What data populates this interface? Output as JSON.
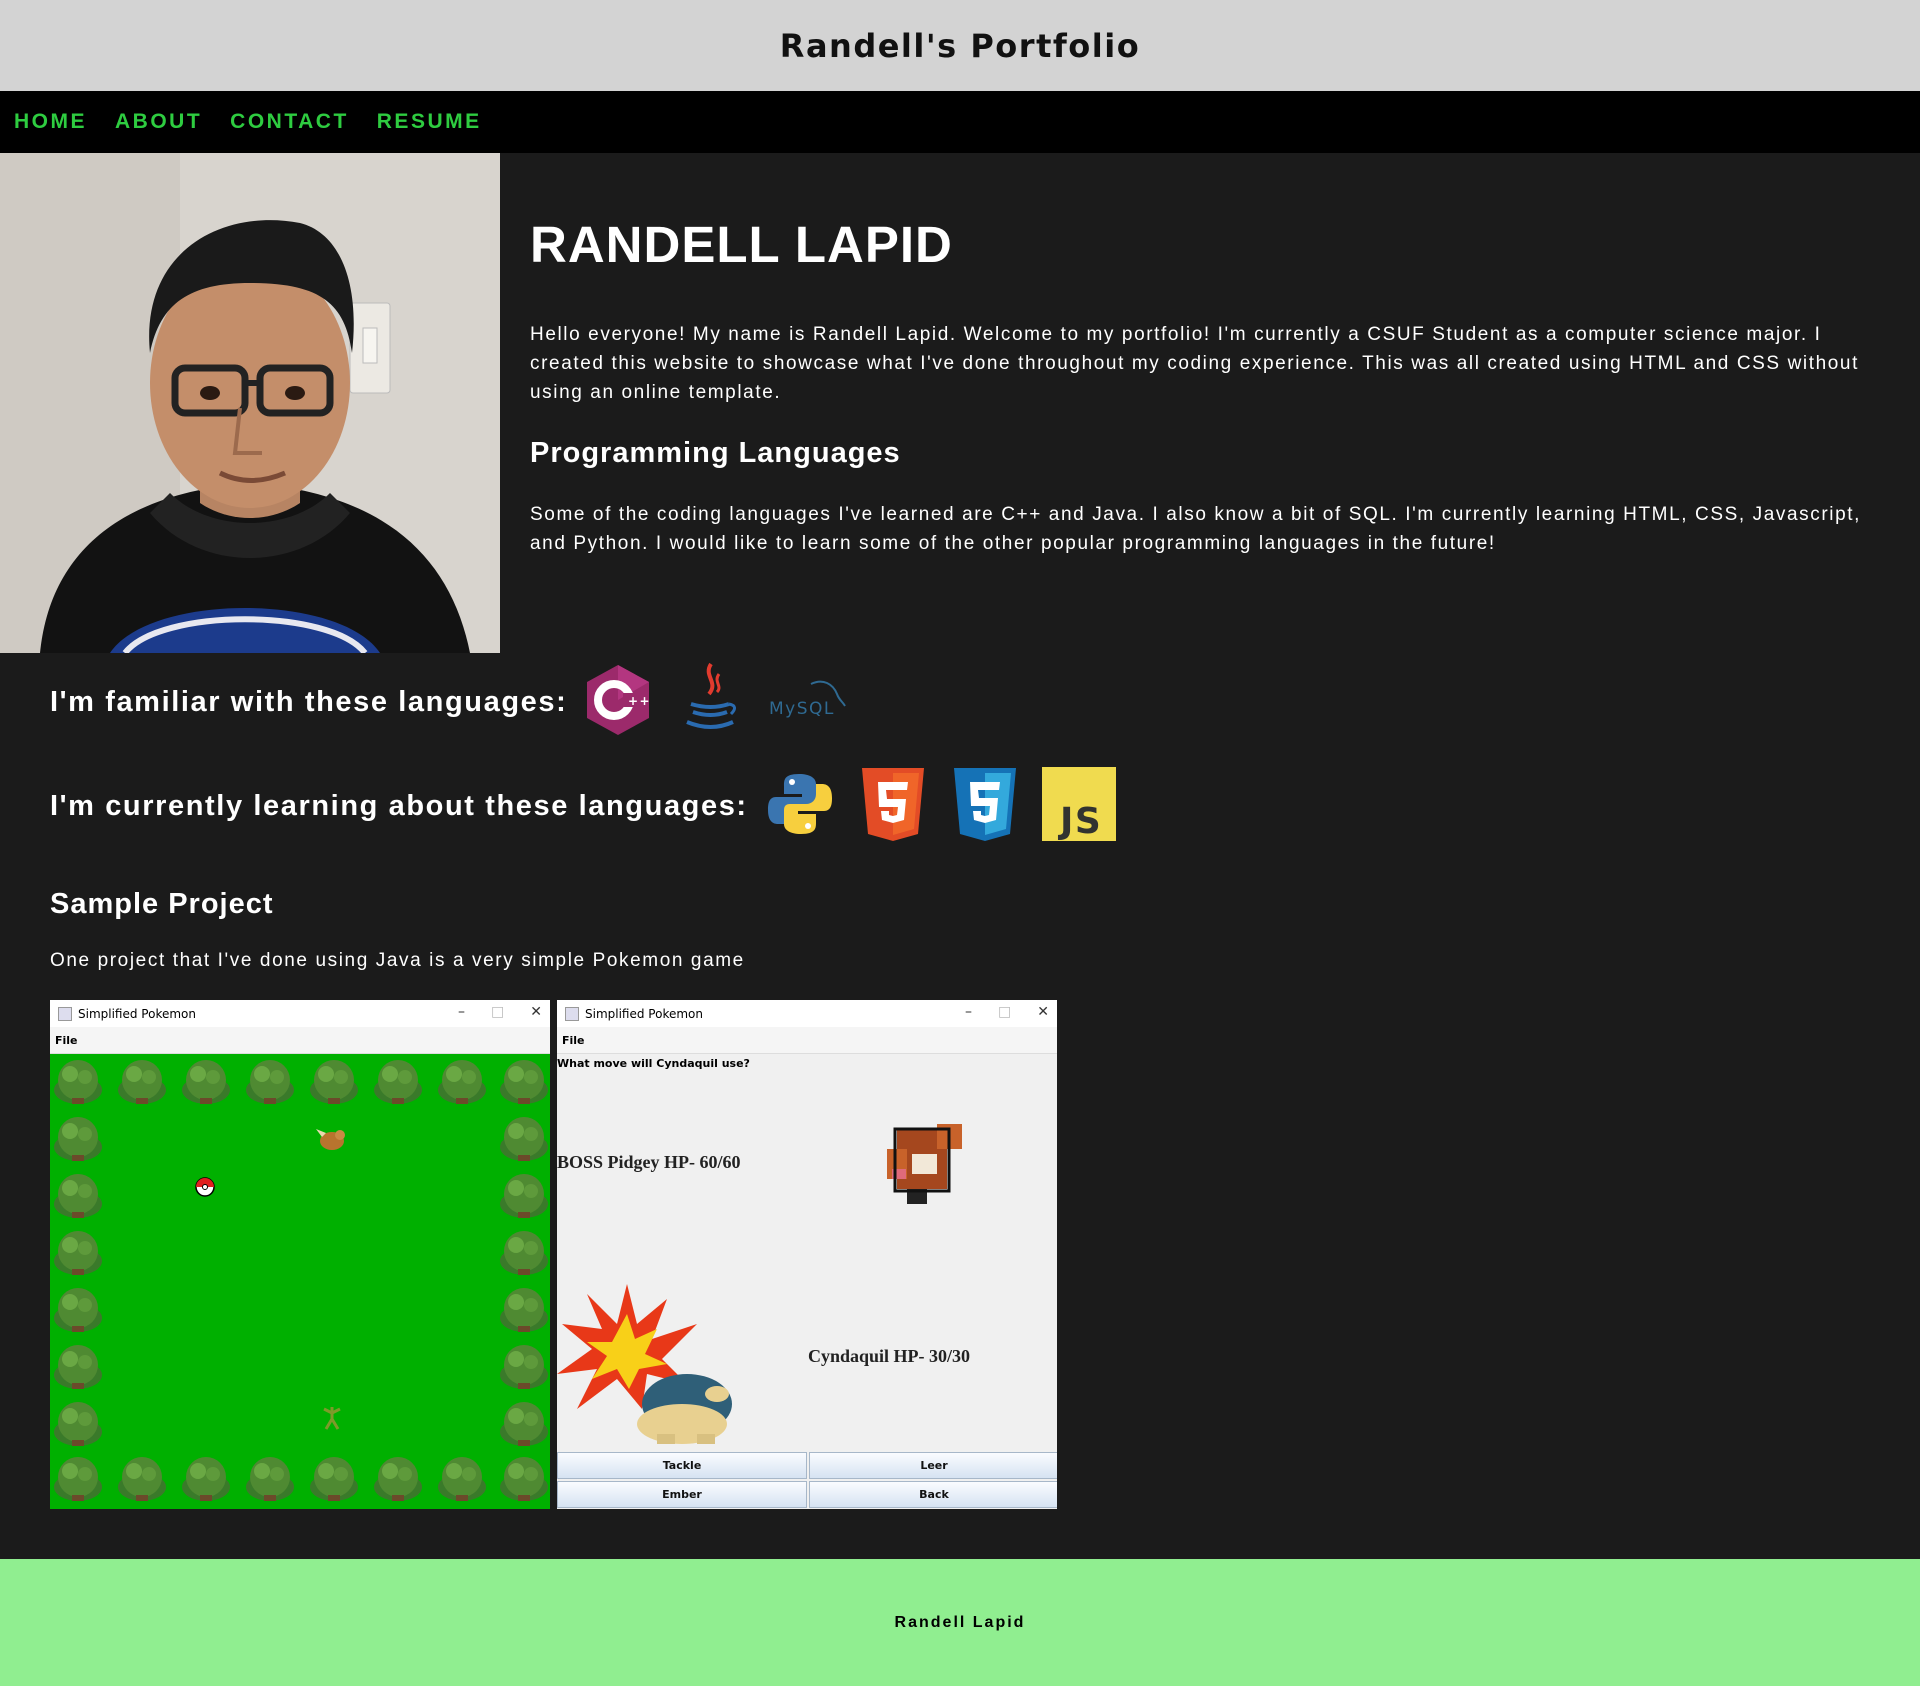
{
  "header": {
    "title": "Randell's Portfolio"
  },
  "nav": {
    "items": [
      "HOME",
      "ABOUT",
      "CONTACT",
      "RESUME"
    ]
  },
  "intro": {
    "name": "RANDELL LAPID",
    "paragraph": "Hello everyone! My name is Randell Lapid. Welcome to my portfolio! I'm currently a CSUF Student as a computer science major. I created this website to showcase what I've done throughout my coding experience. This was all created using HTML and CSS without using an online template.",
    "languages_heading": "Programming Languages",
    "languages_paragraph": "Some of the coding languages I've learned are C++ and Java. I also know a bit of SQL. I'm currently learning HTML, CSS, Javascript, and Python. I would like to learn some of the other popular programming languages in the future!"
  },
  "familiar": {
    "heading": "I'm familiar with these languages:",
    "icons": [
      "cpp-icon",
      "java-icon",
      "mysql-icon"
    ],
    "mysql_text": "MySQL"
  },
  "learning": {
    "heading": "I'm currently learning about these languages:",
    "icons": [
      "python-icon",
      "html5-icon",
      "css3-icon",
      "javascript-icon"
    ],
    "js_text": "JS"
  },
  "sample": {
    "heading": "Sample Project",
    "text": "One project that I've done using Java is a very simple Pokemon game"
  },
  "game": {
    "window_title": "Simplified Pokemon",
    "menu": "File",
    "prompt": "What move will Cyndaquil use?",
    "enemy_hp": "BOSS Pidgey HP- 60/60",
    "player_hp": "Cyndaquil HP- 30/30",
    "moves": [
      "Tackle",
      "Leer",
      "Ember",
      "Back"
    ]
  },
  "footer": {
    "text": "Randell Lapid"
  },
  "colors": {
    "nav_link": "#2ecc40",
    "header_bg": "#d3d3d3",
    "footer_bg": "#90ee90",
    "page_bg": "#1b1b1b"
  }
}
